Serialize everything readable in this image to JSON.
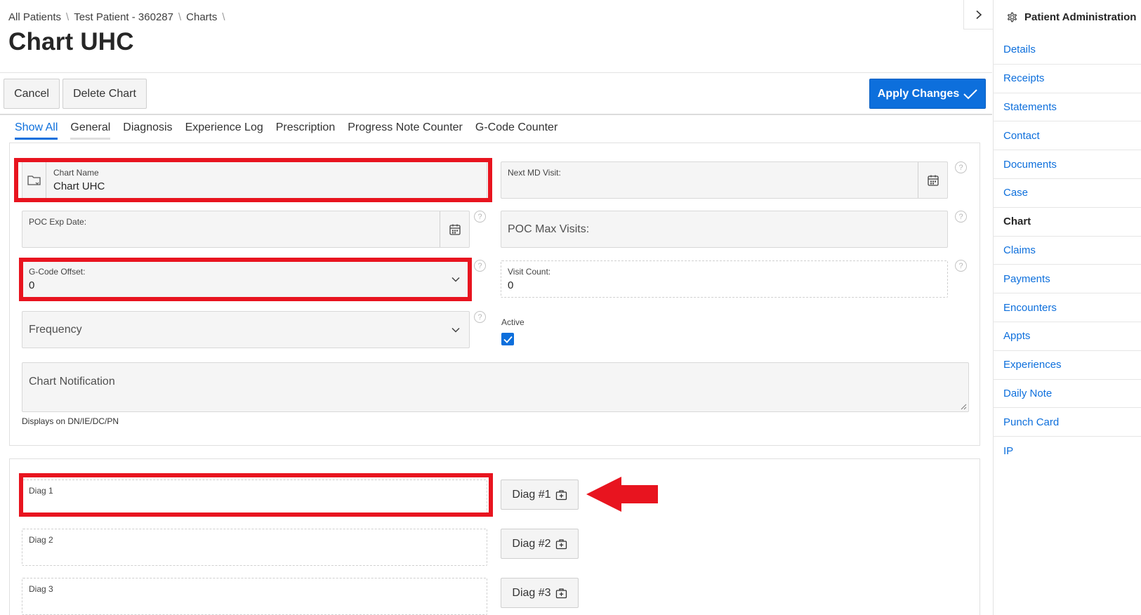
{
  "breadcrumb": [
    "All Patients",
    "Test Patient - 360287",
    "Charts"
  ],
  "page_title": "Chart UHC",
  "toolbar": {
    "cancel_label": "Cancel",
    "delete_label": "Delete Chart",
    "apply_label": "Apply Changes"
  },
  "tabs": [
    {
      "label": "Show All"
    },
    {
      "label": "General"
    },
    {
      "label": "Diagnosis"
    },
    {
      "label": "Experience Log"
    },
    {
      "label": "Prescription"
    },
    {
      "label": "Progress Note Counter"
    },
    {
      "label": "G-Code Counter"
    }
  ],
  "general": {
    "chart_name": {
      "label": "Chart Name",
      "value": "Chart UHC"
    },
    "next_md_visit": {
      "label": "Next MD Visit:",
      "value": ""
    },
    "poc_exp_date": {
      "label": "POC Exp Date:",
      "value": ""
    },
    "poc_max_visits": {
      "placeholder": "POC Max Visits:"
    },
    "gcode_offset": {
      "label": "G-Code Offset:",
      "value": "0"
    },
    "visit_count": {
      "label": "Visit Count:",
      "value": "0"
    },
    "frequency": {
      "placeholder": "Frequency"
    },
    "active": {
      "label": "Active",
      "checked": true
    },
    "chart_notification": {
      "placeholder": "Chart Notification",
      "note": "Displays on DN/IE/DC/PN"
    }
  },
  "diagnosis": {
    "fields": [
      {
        "label": "Diag 1",
        "button": "Diag #1"
      },
      {
        "label": "Diag 2",
        "button": "Diag #2"
      },
      {
        "label": "Diag 3",
        "button": "Diag #3"
      }
    ]
  },
  "right_panel": {
    "title": "Patient Administration",
    "items": [
      {
        "label": "Details"
      },
      {
        "label": "Receipts"
      },
      {
        "label": "Statements"
      },
      {
        "label": "Contact"
      },
      {
        "label": "Documents"
      },
      {
        "label": "Case"
      },
      {
        "label": "Chart"
      },
      {
        "label": "Claims"
      },
      {
        "label": "Payments"
      },
      {
        "label": "Encounters"
      },
      {
        "label": "Appts"
      },
      {
        "label": "Experiences"
      },
      {
        "label": "Daily Note"
      },
      {
        "label": "Punch Card"
      },
      {
        "label": "IP"
      }
    ]
  },
  "colors": {
    "accent": "#0d6fdc",
    "annotation_red": "#e8141f"
  }
}
